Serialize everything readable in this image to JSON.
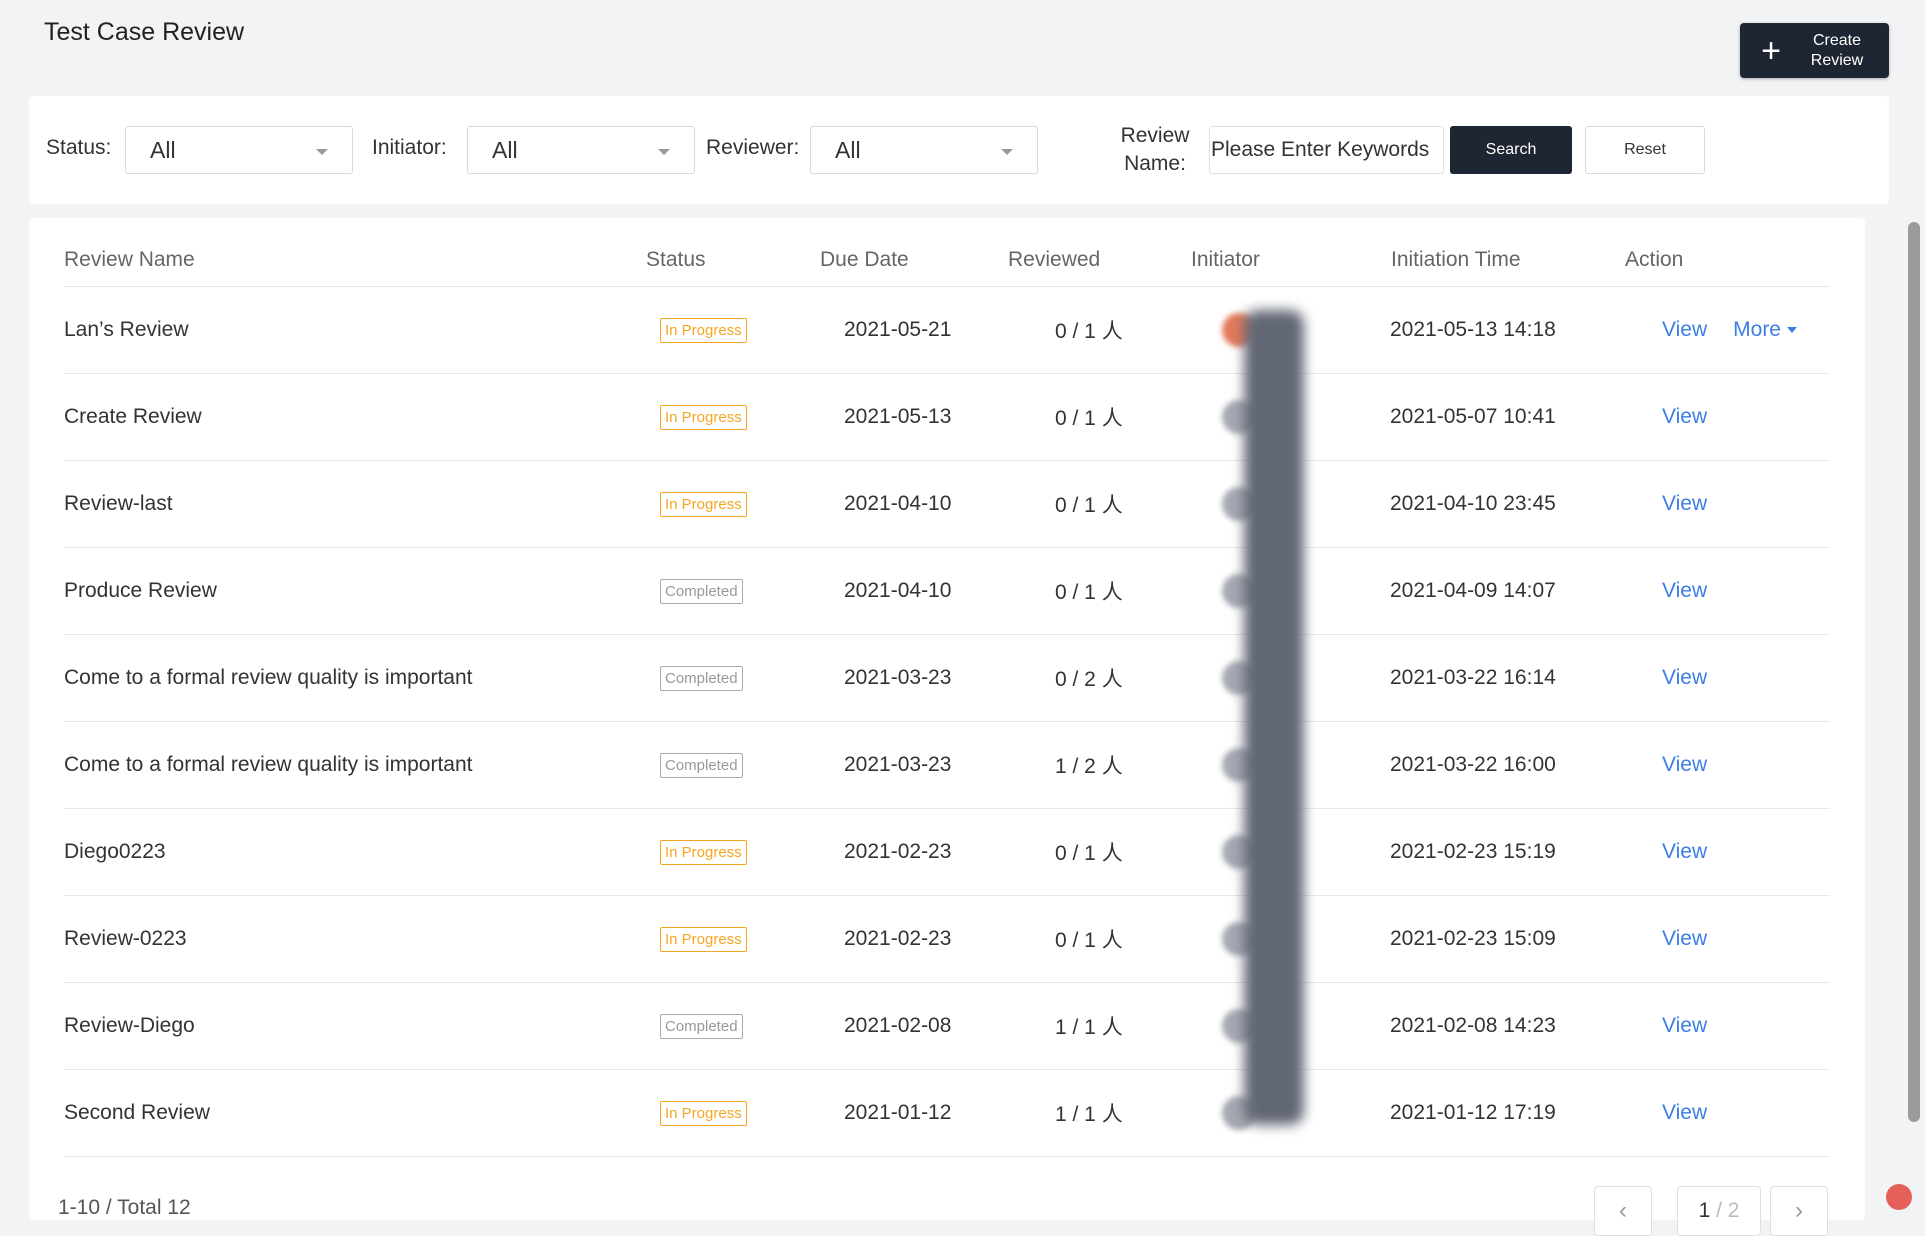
{
  "page": {
    "title": "Test Case Review",
    "create_label_1": "Create",
    "create_label_2": "Review"
  },
  "filters": {
    "status_label": "Status:",
    "status_value": "All",
    "initiator_label": "Initiator:",
    "initiator_value": "All",
    "reviewer_label": "Reviewer:",
    "reviewer_value": "All",
    "review_name_label_1": "Review",
    "review_name_label_2": "Name:",
    "keyword_placeholder": "Please Enter Keywords",
    "search_label": "Search",
    "reset_label": "Reset"
  },
  "table": {
    "headers": [
      "Review Name",
      "Status",
      "Due Date",
      "Reviewed",
      "Initiator",
      "Initiation Time",
      "Action"
    ],
    "rows": [
      {
        "name": "Lan’s Review",
        "status": "In Progress",
        "due": "2021-05-21",
        "reviewed": "0 / 1 人",
        "time": "2021-05-13 14:18",
        "action": "View",
        "more": "More"
      },
      {
        "name": "Create Review",
        "status": "In Progress",
        "due": "2021-05-13",
        "reviewed": "0 / 1 人",
        "time": "2021-05-07 10:41",
        "action": "View"
      },
      {
        "name": "Review-last",
        "status": "In Progress",
        "due": "2021-04-10",
        "reviewed": "0 / 1 人",
        "time": "2021-04-10 23:45",
        "action": "View"
      },
      {
        "name": "Produce Review",
        "status": "Completed",
        "due": "2021-04-10",
        "reviewed": "0 / 1 人",
        "time": "2021-04-09 14:07",
        "action": "View"
      },
      {
        "name": "Come to a formal review quality is important",
        "status": "Completed",
        "due": "2021-03-23",
        "reviewed": "0 / 2 人",
        "time": "2021-03-22 16:14",
        "action": "View"
      },
      {
        "name": "Come to a formal review quality is important",
        "status": "Completed",
        "due": "2021-03-23",
        "reviewed": "1 / 2 人",
        "time": "2021-03-22 16:00",
        "action": "View"
      },
      {
        "name": "Diego0223",
        "status": "In Progress",
        "due": "2021-02-23",
        "reviewed": "0 / 1 人",
        "time": "2021-02-23 15:19",
        "action": "View"
      },
      {
        "name": "Review-0223",
        "status": "In Progress",
        "due": "2021-02-23",
        "reviewed": "0 / 1 人",
        "time": "2021-02-23 15:09",
        "action": "View"
      },
      {
        "name": "Review-Diego",
        "status": "Completed",
        "due": "2021-02-08",
        "reviewed": "1 / 1 人",
        "time": "2021-02-08 14:23",
        "action": "View"
      },
      {
        "name": "Second Review",
        "status": "In Progress",
        "due": "2021-01-12",
        "reviewed": "1 / 1 人",
        "time": "2021-01-12 17:19",
        "action": "View"
      }
    ]
  },
  "pagination": {
    "total_text": "1-10 / Total 12",
    "current": "1",
    "sep_total": " / 2"
  },
  "colors": {
    "accent": "#1f2633",
    "link": "#3d7ee6",
    "in_progress": "#f5a623",
    "completed": "#999999"
  }
}
